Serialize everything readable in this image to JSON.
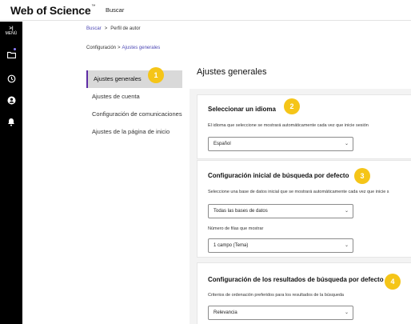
{
  "topbar": {
    "brand": "Web of Science",
    "brand_mark": "™",
    "nav_search": "Buscar"
  },
  "rail": {
    "menu_label": "MENÚ",
    "menu_glyph": ">|",
    "icons": [
      "folder-icon",
      "history-icon",
      "user-icon",
      "bell-icon"
    ],
    "accent": "#8e7dff"
  },
  "breadcrumb": {
    "link": "Buscar",
    "separator": ">",
    "current": "Perfil de autor"
  },
  "subcrumb": {
    "parent": "Configuración",
    "separator": ">",
    "current": "Ajustes generales"
  },
  "side_nav": {
    "items": [
      {
        "label": "Ajustes generales"
      },
      {
        "label": "Ajustes de cuenta"
      },
      {
        "label": "Configuración de comunicaciones"
      },
      {
        "label": "Ajustes de la página de inicio"
      }
    ]
  },
  "main": {
    "title": "Ajustes generales"
  },
  "cards": {
    "language": {
      "title": "Seleccionar un idioma",
      "desc": "El idioma que seleccione se mostrará automáticamente cada vez que inicie sesión",
      "select": "Español"
    },
    "search": {
      "title": "Configuración inicial de búsqueda por defecto",
      "desc": "Seleccione una base de datos inicial que se mostrará automáticamente cada vez que inicie s",
      "db_select": "Todas las bases de datos",
      "rows_label": "Número de filas que mostrar",
      "rows_select": "1 campo (Tema)"
    },
    "results": {
      "title": "Configuración de los resultados de búsqueda por defecto",
      "desc": "Criterios de ordenación preferidos para los resultados de la búsqueda",
      "select": "Relevancia"
    }
  },
  "callouts": [
    "1",
    "2",
    "3",
    "4"
  ],
  "colors": {
    "callout": "#f5c518",
    "accent": "#5e2ca5",
    "link": "#4e49b5"
  }
}
